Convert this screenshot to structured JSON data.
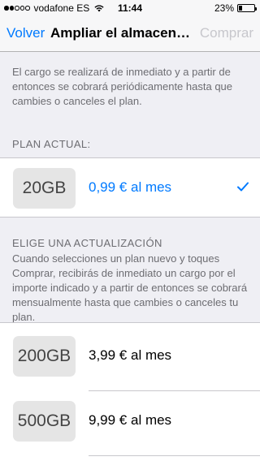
{
  "status_bar": {
    "carrier": "vodafone ES",
    "time": "11:44",
    "battery": "23%",
    "battery_level": 0.23,
    "signal_bars": 2,
    "signal_total": 5
  },
  "nav": {
    "back_label": "Volver",
    "title": "Ampliar el almacenamiento",
    "right_label": "Comprar"
  },
  "info": {
    "text": "El cargo se realizará de inmediato y a partir de entonces se cobrará periódicamente hasta que cambies o canceles el plan."
  },
  "current_plan": {
    "header": "PLAN ACTUAL:",
    "size": "20GB",
    "price": "0,99 € al mes"
  },
  "upgrade": {
    "header": "ELIGE UNA ACTUALIZACIÓN",
    "text": "Cuando selecciones un plan nuevo y toques Comprar, recibirás de inmediato un cargo por el importe indicado y a partir de entonces se cobrará mensualmente hasta que cambies o canceles tu plan.",
    "plans": [
      {
        "size": "200GB",
        "price": "3,99 € al mes"
      },
      {
        "size": "500GB",
        "price": "9,99 € al mes"
      }
    ]
  },
  "colors": {
    "accent": "#007aff",
    "disabled": "#c7c7cc",
    "background": "#efeff4"
  }
}
